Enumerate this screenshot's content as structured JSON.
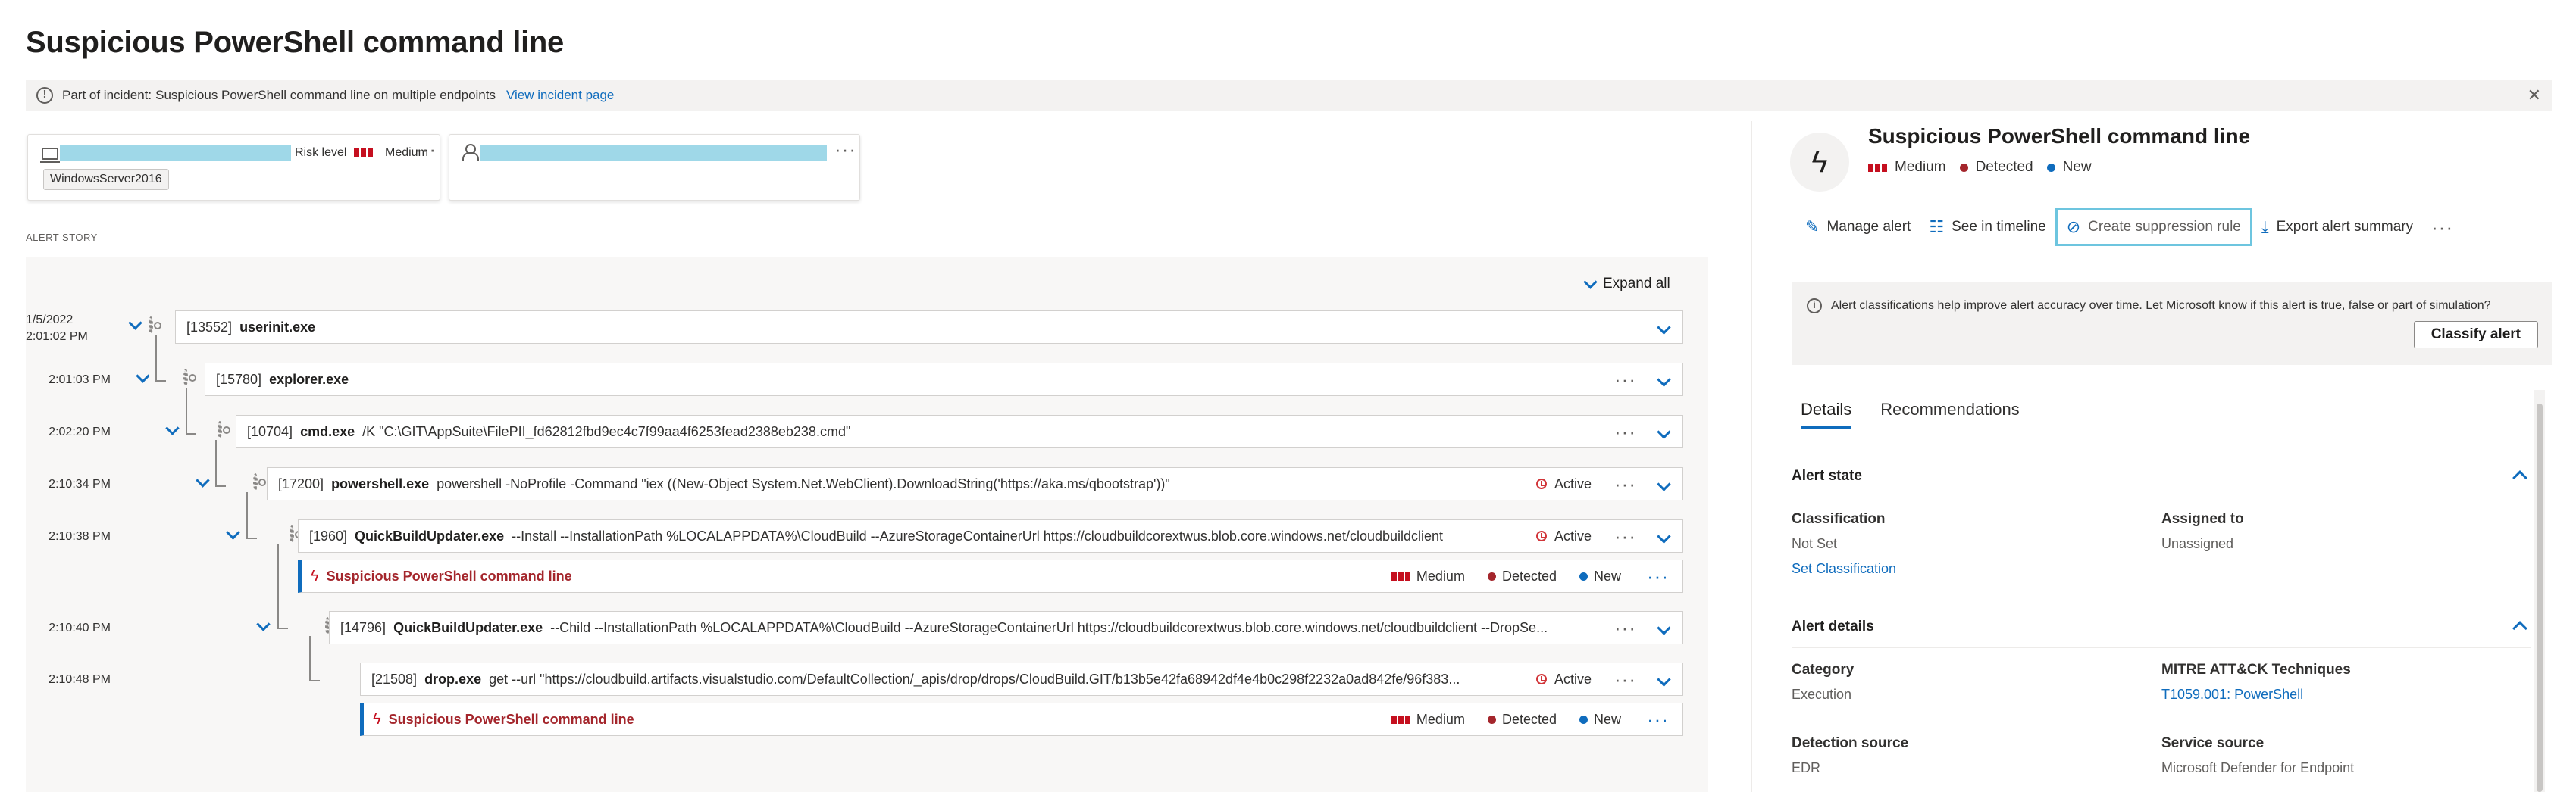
{
  "page_title": "Suspicious PowerShell command line",
  "banner": {
    "label": "Part of incident:",
    "incident_name": "Suspicious PowerShell command line on multiple endpoints",
    "link": "View incident page"
  },
  "device_card": {
    "risk_label": "Risk level",
    "severity": "Medium",
    "os_tag": "WindowsServer2016"
  },
  "story_heading": "ALERT STORY",
  "expand_all": "Expand all",
  "process_tree": [
    {
      "time": [
        "1/5/2022",
        "2:01:02 PM"
      ],
      "pid": "[13552]",
      "name": "userinit.exe",
      "cmd": "",
      "status": ""
    },
    {
      "time": [
        "2:01:03 PM"
      ],
      "pid": "[15780]",
      "name": "explorer.exe",
      "cmd": "",
      "status": ""
    },
    {
      "time": [
        "2:02:20 PM"
      ],
      "pid": "[10704]",
      "name": "cmd.exe",
      "cmd": "/K \"C:\\GIT\\AppSuite\\FilePII_fd62812fbd9ec4c7f99aa4f6253fead2388eb238.cmd\"",
      "status": ""
    },
    {
      "time": [
        "2:10:34 PM"
      ],
      "pid": "[17200]",
      "name": "powershell.exe",
      "cmd": "powershell -NoProfile -Command \"iex ((New-Object System.Net.WebClient).DownloadString('https://aka.ms/qbootstrap'))\"",
      "status": "Active"
    },
    {
      "time": [
        "2:10:38 PM"
      ],
      "pid": "[1960]",
      "name": "QuickBuildUpdater.exe",
      "cmd": "--Install --InstallationPath %LOCALAPPDATA%\\CloudBuild --AzureStorageContainerUrl https://cloudbuildcorextwus.blob.core.windows.net/cloudbuildclient",
      "status": "Active"
    },
    {
      "time": [
        "2:10:40 PM"
      ],
      "pid": "[14796]",
      "name": "QuickBuildUpdater.exe",
      "cmd": "--Child --InstallationPath %LOCALAPPDATA%\\CloudBuild --AzureStorageContainerUrl https://cloudbuildcorextwus.blob.core.windows.net/cloudbuildclient --DropSe...",
      "status": ""
    },
    {
      "time": [
        "2:10:48 PM"
      ],
      "pid": "[21508]",
      "name": "drop.exe",
      "cmd": "get --url \"https://cloudbuild.artifacts.visualstudio.com/DefaultCollection/_apis/drop/drops/CloudBuild.GIT/b13b5e42fa68942df4e4b0c298f2232a0ad842fe/96f383...",
      "status": "Active"
    }
  ],
  "inline_alerts": [
    {
      "name": "Suspicious PowerShell command line",
      "severity": "Medium",
      "detection": "Detected",
      "state": "New"
    },
    {
      "name": "Suspicious PowerShell command line",
      "severity": "Medium",
      "detection": "Detected",
      "state": "New"
    }
  ],
  "right_panel": {
    "title": "Suspicious PowerShell command line",
    "severity": "Medium",
    "detection": "Detected",
    "state": "New",
    "actions": {
      "manage": "Manage alert",
      "timeline": "See in timeline",
      "suppression": "Create suppression rule",
      "export": "Export alert summary"
    },
    "classify_text": "Alert classifications help improve alert accuracy over time. Let Microsoft know if this alert is true, false or part of simulation?",
    "classify_button": "Classify alert",
    "tabs": [
      "Details",
      "Recommendations"
    ],
    "alert_state": {
      "heading": "Alert state",
      "classification_label": "Classification",
      "classification_value": "Not Set",
      "set_link": "Set Classification",
      "assigned_label": "Assigned to",
      "assigned_value": "Unassigned"
    },
    "alert_details": {
      "heading": "Alert details",
      "category_label": "Category",
      "category_value": "Execution",
      "mitre_label": "MITRE ATT&CK Techniques",
      "mitre_value": "T1059.001: PowerShell",
      "detection_source_label": "Detection source",
      "detection_source_value": "EDR",
      "service_source_label": "Service source",
      "service_source_value": "Microsoft Defender for Endpoint"
    }
  },
  "colors": {
    "accent": "#0f6cbd",
    "severity_red": "#c50f1f",
    "alert_red": "#a4262c",
    "redaction": "#9fd8e8"
  }
}
